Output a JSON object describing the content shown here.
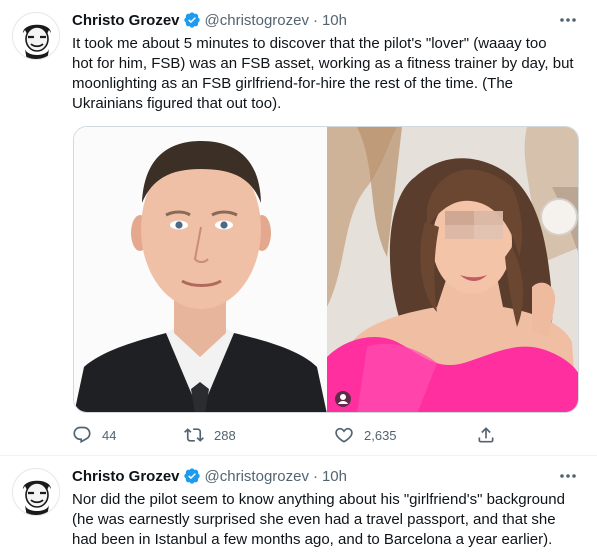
{
  "tweets": [
    {
      "author": {
        "name": "Christo Grozev",
        "handle": "@christogrozev",
        "verified_icon": "verified-badge-icon",
        "avatar_icon": "avatar-illustration"
      },
      "separator": "·",
      "time": "10h",
      "text": "It took me about 5 minutes to discover that the pilot's \"lover\" (waaay too\nhot for him, FSB) was an FSB asset, working as a fitness trainer by day, but\nmoonlighting as an FSB girlfriend-for-hire the rest of the time. (The\nUkrainians figured that out too).",
      "media": [
        {
          "description_icon": "photo-man-in-suit"
        },
        {
          "description_icon": "photo-woman-pink-dress-blurred-eyes"
        }
      ],
      "stats": {
        "replies": "44",
        "retweets": "288",
        "likes": "2,635"
      }
    },
    {
      "author": {
        "name": "Christo Grozev",
        "handle": "@christogrozev",
        "verified_icon": "verified-badge-icon",
        "avatar_icon": "avatar-illustration"
      },
      "separator": "·",
      "time": "10h",
      "text": "Nor did the pilot seem to know anything about his \"girlfriend's\" background\n(he was earnestly surprised she even had a travel passport, and that she\nhad been in Istanbul a few months ago, and to Barcelona a year earlier)."
    }
  ],
  "colors": {
    "verified": "#1d9bf0",
    "secondary_text": "#536471",
    "primary_text": "#0f1419",
    "border": "#cfd9de"
  }
}
